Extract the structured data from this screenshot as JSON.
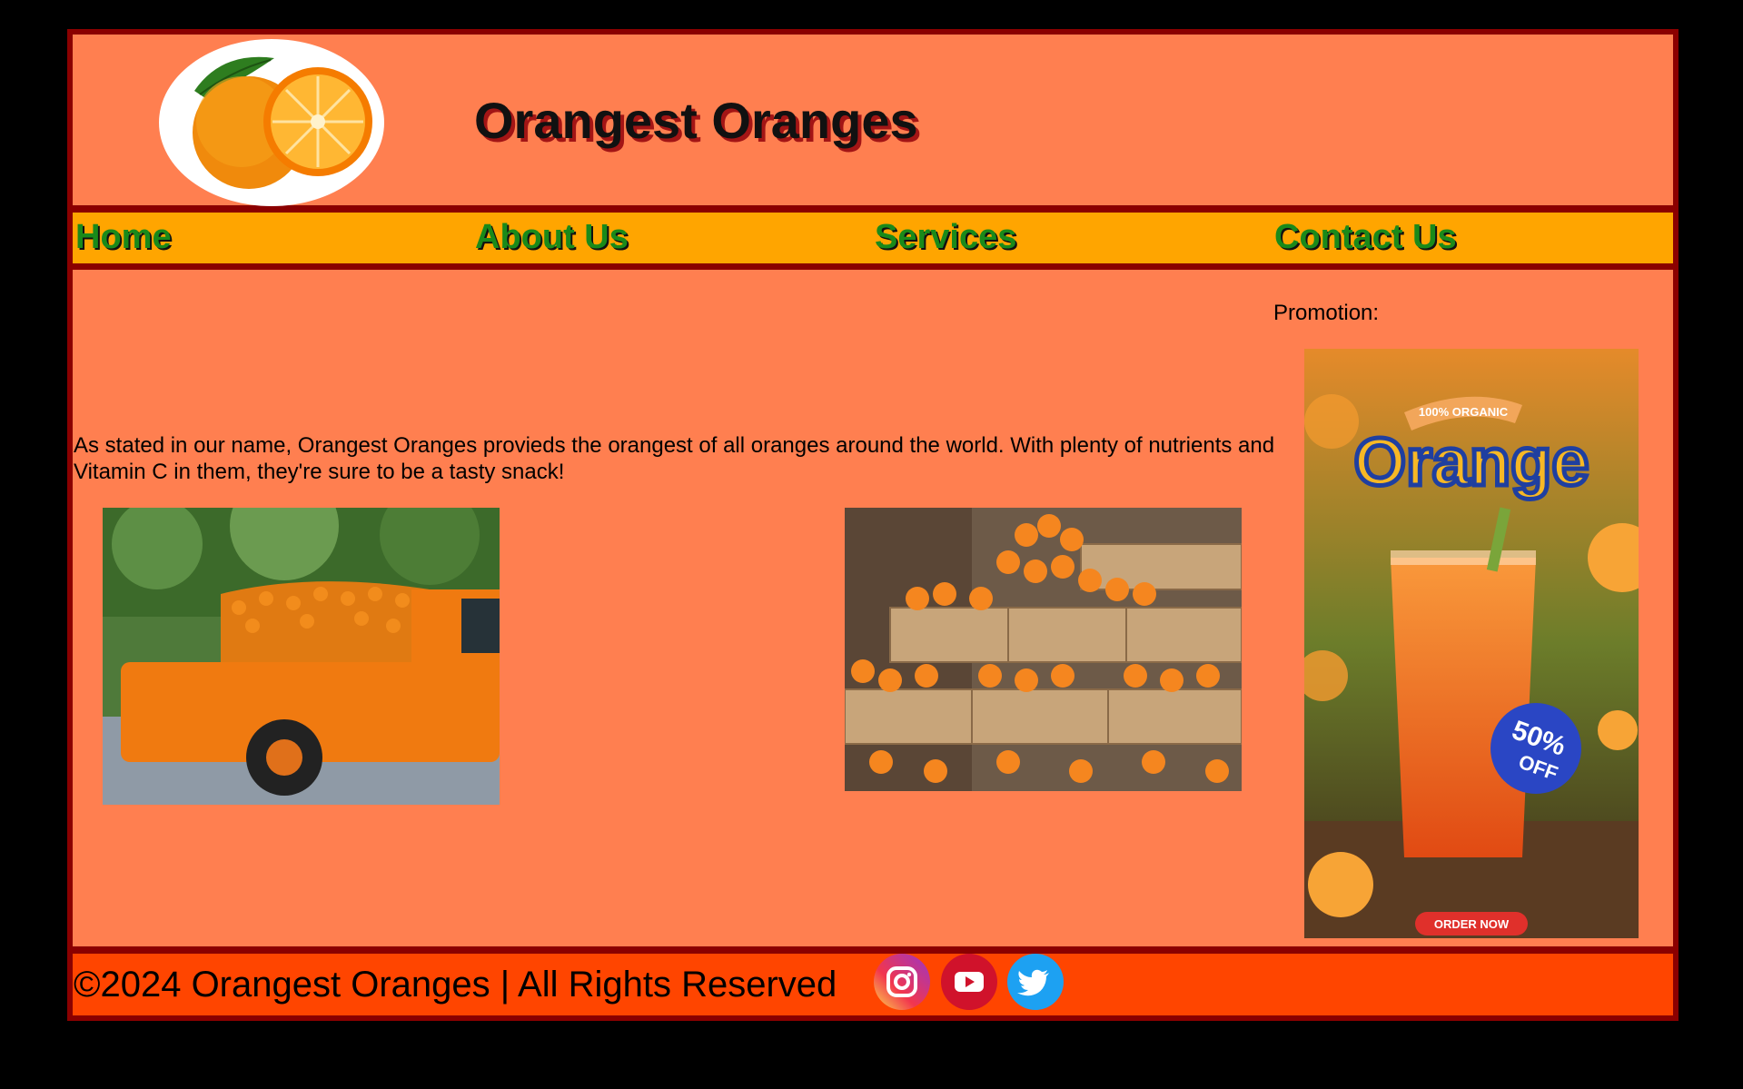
{
  "header": {
    "title": "Orangest Oranges"
  },
  "nav": {
    "items": [
      {
        "label": "Home"
      },
      {
        "label": "About Us"
      },
      {
        "label": "Services"
      },
      {
        "label": "Contact Us"
      }
    ]
  },
  "main": {
    "intro": "As stated in our name, Orangest Oranges provieds the orangest of all oranges around the world. With plenty of nutrients and Vitamin C in them, they're sure to be a tasty snack!"
  },
  "promotion": {
    "label": "Promotion:",
    "badge_top": "100% ORGANIC",
    "headline": "Orange",
    "discount_line1": "50%",
    "discount_line2": "OFF",
    "cta": "ORDER NOW"
  },
  "footer": {
    "copyright": "©2024 Orangest Oranges | All Rights Reserved",
    "social": [
      {
        "icon": "instagram-icon"
      },
      {
        "icon": "youtube-icon"
      },
      {
        "icon": "twitter-icon"
      }
    ]
  },
  "colors": {
    "page_background": "#000000",
    "border": "#8b0000",
    "header_background": "#ff7f50",
    "nav_background": "#ffa500",
    "nav_text": "#1a8a1a",
    "footer_background": "#ff4500"
  }
}
